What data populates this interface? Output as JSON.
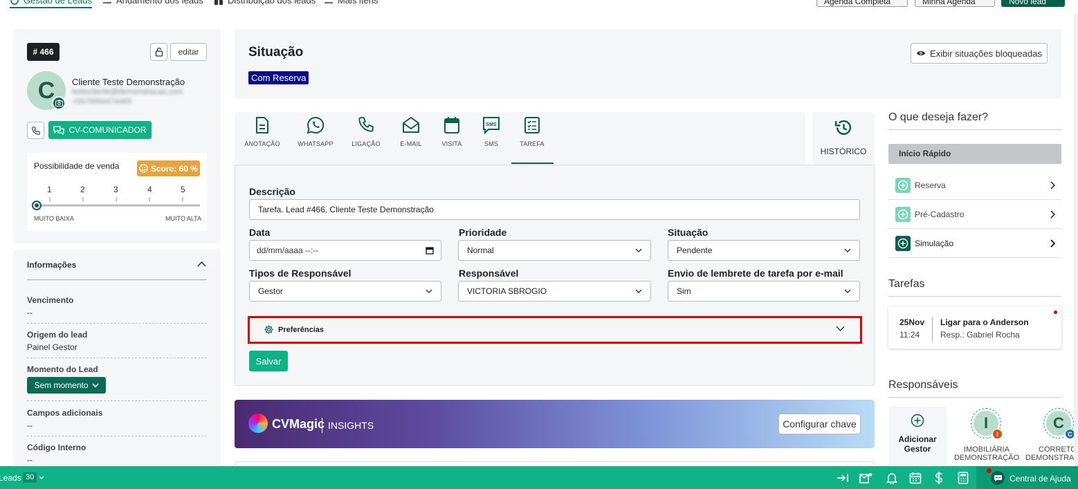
{
  "nav": {
    "tabs": [
      "Gestão de Leads",
      "Andamento dos leads",
      "Distribuição dos leads",
      "Mais itens"
    ],
    "buttons": {
      "agenda_completa": "Agenda Completa",
      "minha_agenda": "Minha Agenda",
      "novo_lead": "Novo lead"
    }
  },
  "lead": {
    "id": "# 466",
    "edit_label": "editar",
    "name": "Cliente Teste Demonstração",
    "email": "testecliente@demonstracao.com",
    "phone": "+5579994474465",
    "avatar_letter": "C",
    "communicator_label": "CV-COMUNICADOR"
  },
  "sale_chance": {
    "title": "Possibilidade de venda",
    "score": "Score: 60 %",
    "ticks": [
      "1",
      "2",
      "3",
      "4",
      "5"
    ],
    "min_label": "MUITO BAIXA",
    "max_label": "MUITO ALTA",
    "selected": 0
  },
  "info": {
    "title": "Informações",
    "fields": [
      {
        "label": "Vencimento",
        "value": "--"
      },
      {
        "label": "Origem do lead",
        "value": "Painel Gestor"
      },
      {
        "label": "Momento do Lead",
        "value": "Sem momento"
      },
      {
        "label": "Campos adicionais",
        "value": "--"
      },
      {
        "label": "Código Interno",
        "value": "--"
      }
    ]
  },
  "situation": {
    "title": "Situação",
    "badge": "Com Reserva",
    "show_blocked": "Exibir situações bloqueadas"
  },
  "actions": {
    "tabs": [
      "ANOTAÇÃO",
      "WHATSAPP",
      "LIGAÇÃO",
      "E-MAIL",
      "VISITA",
      "SMS",
      "TAREFA"
    ],
    "active": "TAREFA",
    "history": "HISTÓRICO"
  },
  "task_form": {
    "description_label": "Descrição",
    "description_value": "Tarefa. Lead #466, Cliente Teste Demonstração",
    "date_label": "Data",
    "date_placeholder": "dd/mm/aaaa --:--",
    "priority_label": "Prioridade",
    "priority_value": "Normal",
    "status_label": "Situação",
    "status_value": "Pendente",
    "resp_type_label": "Tipos de Responsável",
    "resp_type_value": "Gestor",
    "responsible_label": "Responsável",
    "responsible_value": "VICTORIA SBROGIO",
    "reminder_label": "Envio de lembrete de tarefa por e-mail",
    "reminder_value": "Sim",
    "preferences_label": "Preferências",
    "save_label": "Salvar"
  },
  "cvmagic": {
    "brand": "CVMagic",
    "sub": "INSIGHTS",
    "config_button": "Configurar chave"
  },
  "right_panel": {
    "question": "O que deseja fazer?",
    "quick_start": "Início Rápido",
    "items": [
      "Reserva",
      "Pré-Cadastro",
      "Simulação"
    ],
    "tasks_title": "Tarefas",
    "task": {
      "day": "25Nov",
      "time": "11:24",
      "title": "Ligar para o Anderson",
      "resp": "Resp.: Gabriel Rocha"
    },
    "responsibles_title": "Responsáveis",
    "add_manager": "Adicionar Gestor",
    "people": [
      {
        "letter": "I",
        "badge": "I",
        "label1": "IMOBILIÁRIA",
        "label2": "DEMONSTRAÇÃO"
      },
      {
        "letter": "C",
        "badge": "C",
        "label1": "CORRETOR",
        "label2": "DEMONSTRAÇÃO"
      }
    ]
  },
  "bottom": {
    "leads_label": "Leads",
    "leads_count": "30",
    "help_label": "Central de Ajuda"
  },
  "colors": {
    "primary": "#10b386",
    "dark_green": "#065f46",
    "badge_blue": "#0a0a8a",
    "score": "#e8a33c",
    "highlight": "#e00000"
  }
}
